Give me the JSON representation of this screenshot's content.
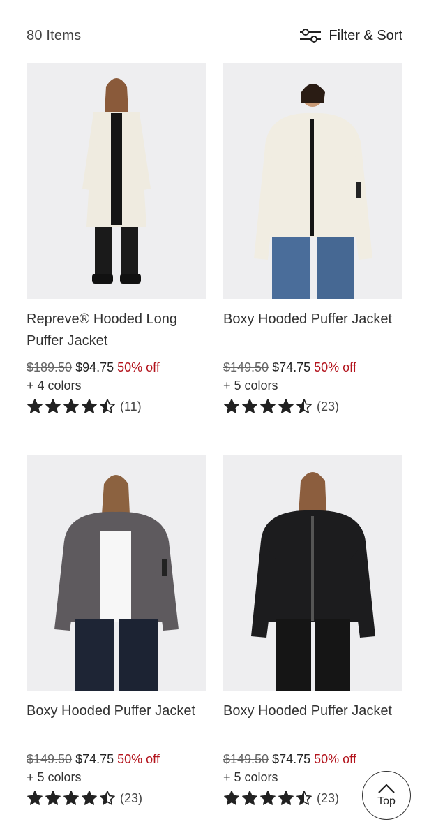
{
  "header": {
    "item_count": "80 Items",
    "filter_label": "Filter & Sort"
  },
  "products": [
    {
      "title": "Repreve® Hooded Long Puffer Jacket",
      "original_price": "$189.50",
      "sale_price": "$94.75",
      "discount": "50% off",
      "colors": "+ 4 colors",
      "rating": 4.5,
      "reviews": "(11)",
      "jacket_color": "#efebe0"
    },
    {
      "title": "Boxy Hooded Puffer Jacket",
      "original_price": "$149.50",
      "sale_price": "$74.75",
      "discount": "50% off",
      "colors": "+ 5 colors",
      "rating": 4.5,
      "reviews": "(23)",
      "jacket_color": "#f1ede2"
    },
    {
      "title": "Boxy Hooded Puffer Jacket",
      "original_price": "$149.50",
      "sale_price": "$74.75",
      "discount": "50% off",
      "colors": "+ 5 colors",
      "rating": 4.5,
      "reviews": "(23)",
      "jacket_color": "#5e5a5e"
    },
    {
      "title": "Boxy Hooded Puffer Jacket",
      "original_price": "$149.50",
      "sale_price": "$74.75",
      "discount": "50% off",
      "colors": "+ 5 colors",
      "rating": 4.5,
      "reviews": "(23)",
      "jacket_color": "#1c1c1e"
    }
  ],
  "scroll_top": {
    "label": "Top"
  },
  "colors": {
    "sale_red": "#b3141d",
    "star": "#222222"
  }
}
